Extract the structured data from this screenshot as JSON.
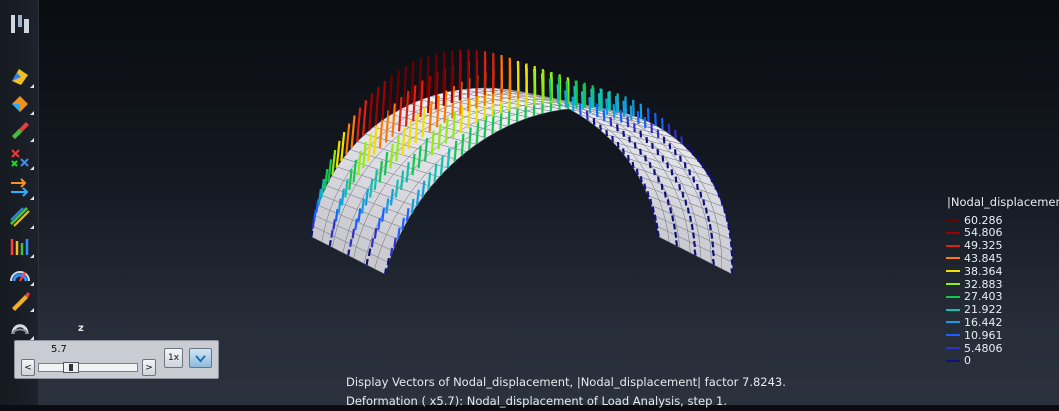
{
  "toolbar": {
    "tools": [
      {
        "name": "view-result-icon"
      },
      {
        "name": "contour-fill-icon"
      },
      {
        "name": "contour-lines-icon"
      },
      {
        "name": "smooth-contour-icon"
      },
      {
        "name": "display-vectors-icon"
      },
      {
        "name": "line-diagram-icon"
      },
      {
        "name": "iso-surfaces-icon"
      },
      {
        "name": "vector-field-icon"
      },
      {
        "name": "gauge-icon"
      },
      {
        "name": "color-pen-icon"
      },
      {
        "name": "deformation-icon"
      }
    ]
  },
  "legend": {
    "title": "|Nodal_displacement|",
    "entries": [
      {
        "value": "60.286",
        "color": "#6b0000"
      },
      {
        "value": "54.806",
        "color": "#a00000"
      },
      {
        "value": "49.325",
        "color": "#e02010"
      },
      {
        "value": "43.845",
        "color": "#ff7a00"
      },
      {
        "value": "38.364",
        "color": "#f0e000"
      },
      {
        "value": "32.883",
        "color": "#90ee10"
      },
      {
        "value": "27.403",
        "color": "#12c850"
      },
      {
        "value": "21.922",
        "color": "#10c0b0"
      },
      {
        "value": "16.442",
        "color": "#10a0e0"
      },
      {
        "value": "10.961",
        "color": "#1860ff"
      },
      {
        "value": "5.4806",
        "color": "#3030c8"
      },
      {
        "value": "0",
        "color": "#101080"
      }
    ]
  },
  "axis": {
    "label": "z"
  },
  "animation": {
    "value": "5.7",
    "speed_label": "1x",
    "prev_label": "<",
    "next_label": ">",
    "position": 0.28
  },
  "caption": {
    "line1": "Display Vectors of Nodal_displacement, |Nodal_displacement| factor 7.8243.",
    "line2": "Deformation ( x5.7): Nodal_displacement of Load Analysis, step 1."
  }
}
